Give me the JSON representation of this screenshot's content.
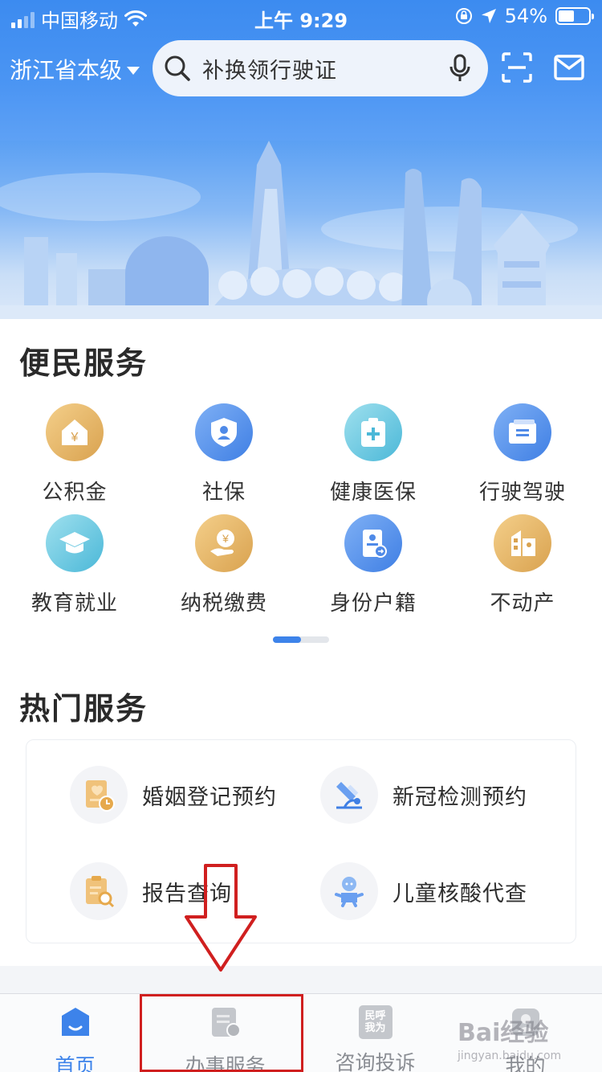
{
  "status_bar": {
    "carrier": "中国移动",
    "time": "上午 9:29",
    "battery": "54%",
    "battery_level": 0.54
  },
  "header": {
    "region": "浙江省本级",
    "search_placeholder": "补换领行驶证"
  },
  "convenience": {
    "title": "便民服务",
    "items": [
      {
        "label": "公积金",
        "icon": "housing-fund-icon"
      },
      {
        "label": "社保",
        "icon": "social-security-icon"
      },
      {
        "label": "健康医保",
        "icon": "medical-insurance-icon"
      },
      {
        "label": "行驶驾驶",
        "icon": "driving-license-icon"
      },
      {
        "label": "教育就业",
        "icon": "education-icon"
      },
      {
        "label": "纳税缴费",
        "icon": "tax-payment-icon"
      },
      {
        "label": "身份户籍",
        "icon": "id-household-icon"
      },
      {
        "label": "不动产",
        "icon": "real-estate-icon"
      }
    ],
    "page_index": 1,
    "page_count": 2
  },
  "hot": {
    "title": "热门服务",
    "items": [
      {
        "label": "婚姻登记预约",
        "icon": "marriage-registration-icon"
      },
      {
        "label": "新冠检测预约",
        "icon": "covid-test-icon"
      },
      {
        "label": "报告查询",
        "icon": "report-query-icon"
      },
      {
        "label": "儿童核酸代查",
        "icon": "child-test-icon"
      }
    ]
  },
  "tabbar": {
    "tabs": [
      {
        "label": "首页",
        "active": true
      },
      {
        "label": "办事服务",
        "active": false
      },
      {
        "label": "咨询投诉",
        "active": false,
        "icon_text": "民呼我为"
      },
      {
        "label": "我的",
        "active": false
      }
    ]
  },
  "colors": {
    "primary": "#3d83ea",
    "header_blue": "#3c8bf0",
    "annotation_red": "#d01f1f"
  },
  "watermark": {
    "brand": "Bai经验",
    "url": "jingyan.baidu.com"
  }
}
